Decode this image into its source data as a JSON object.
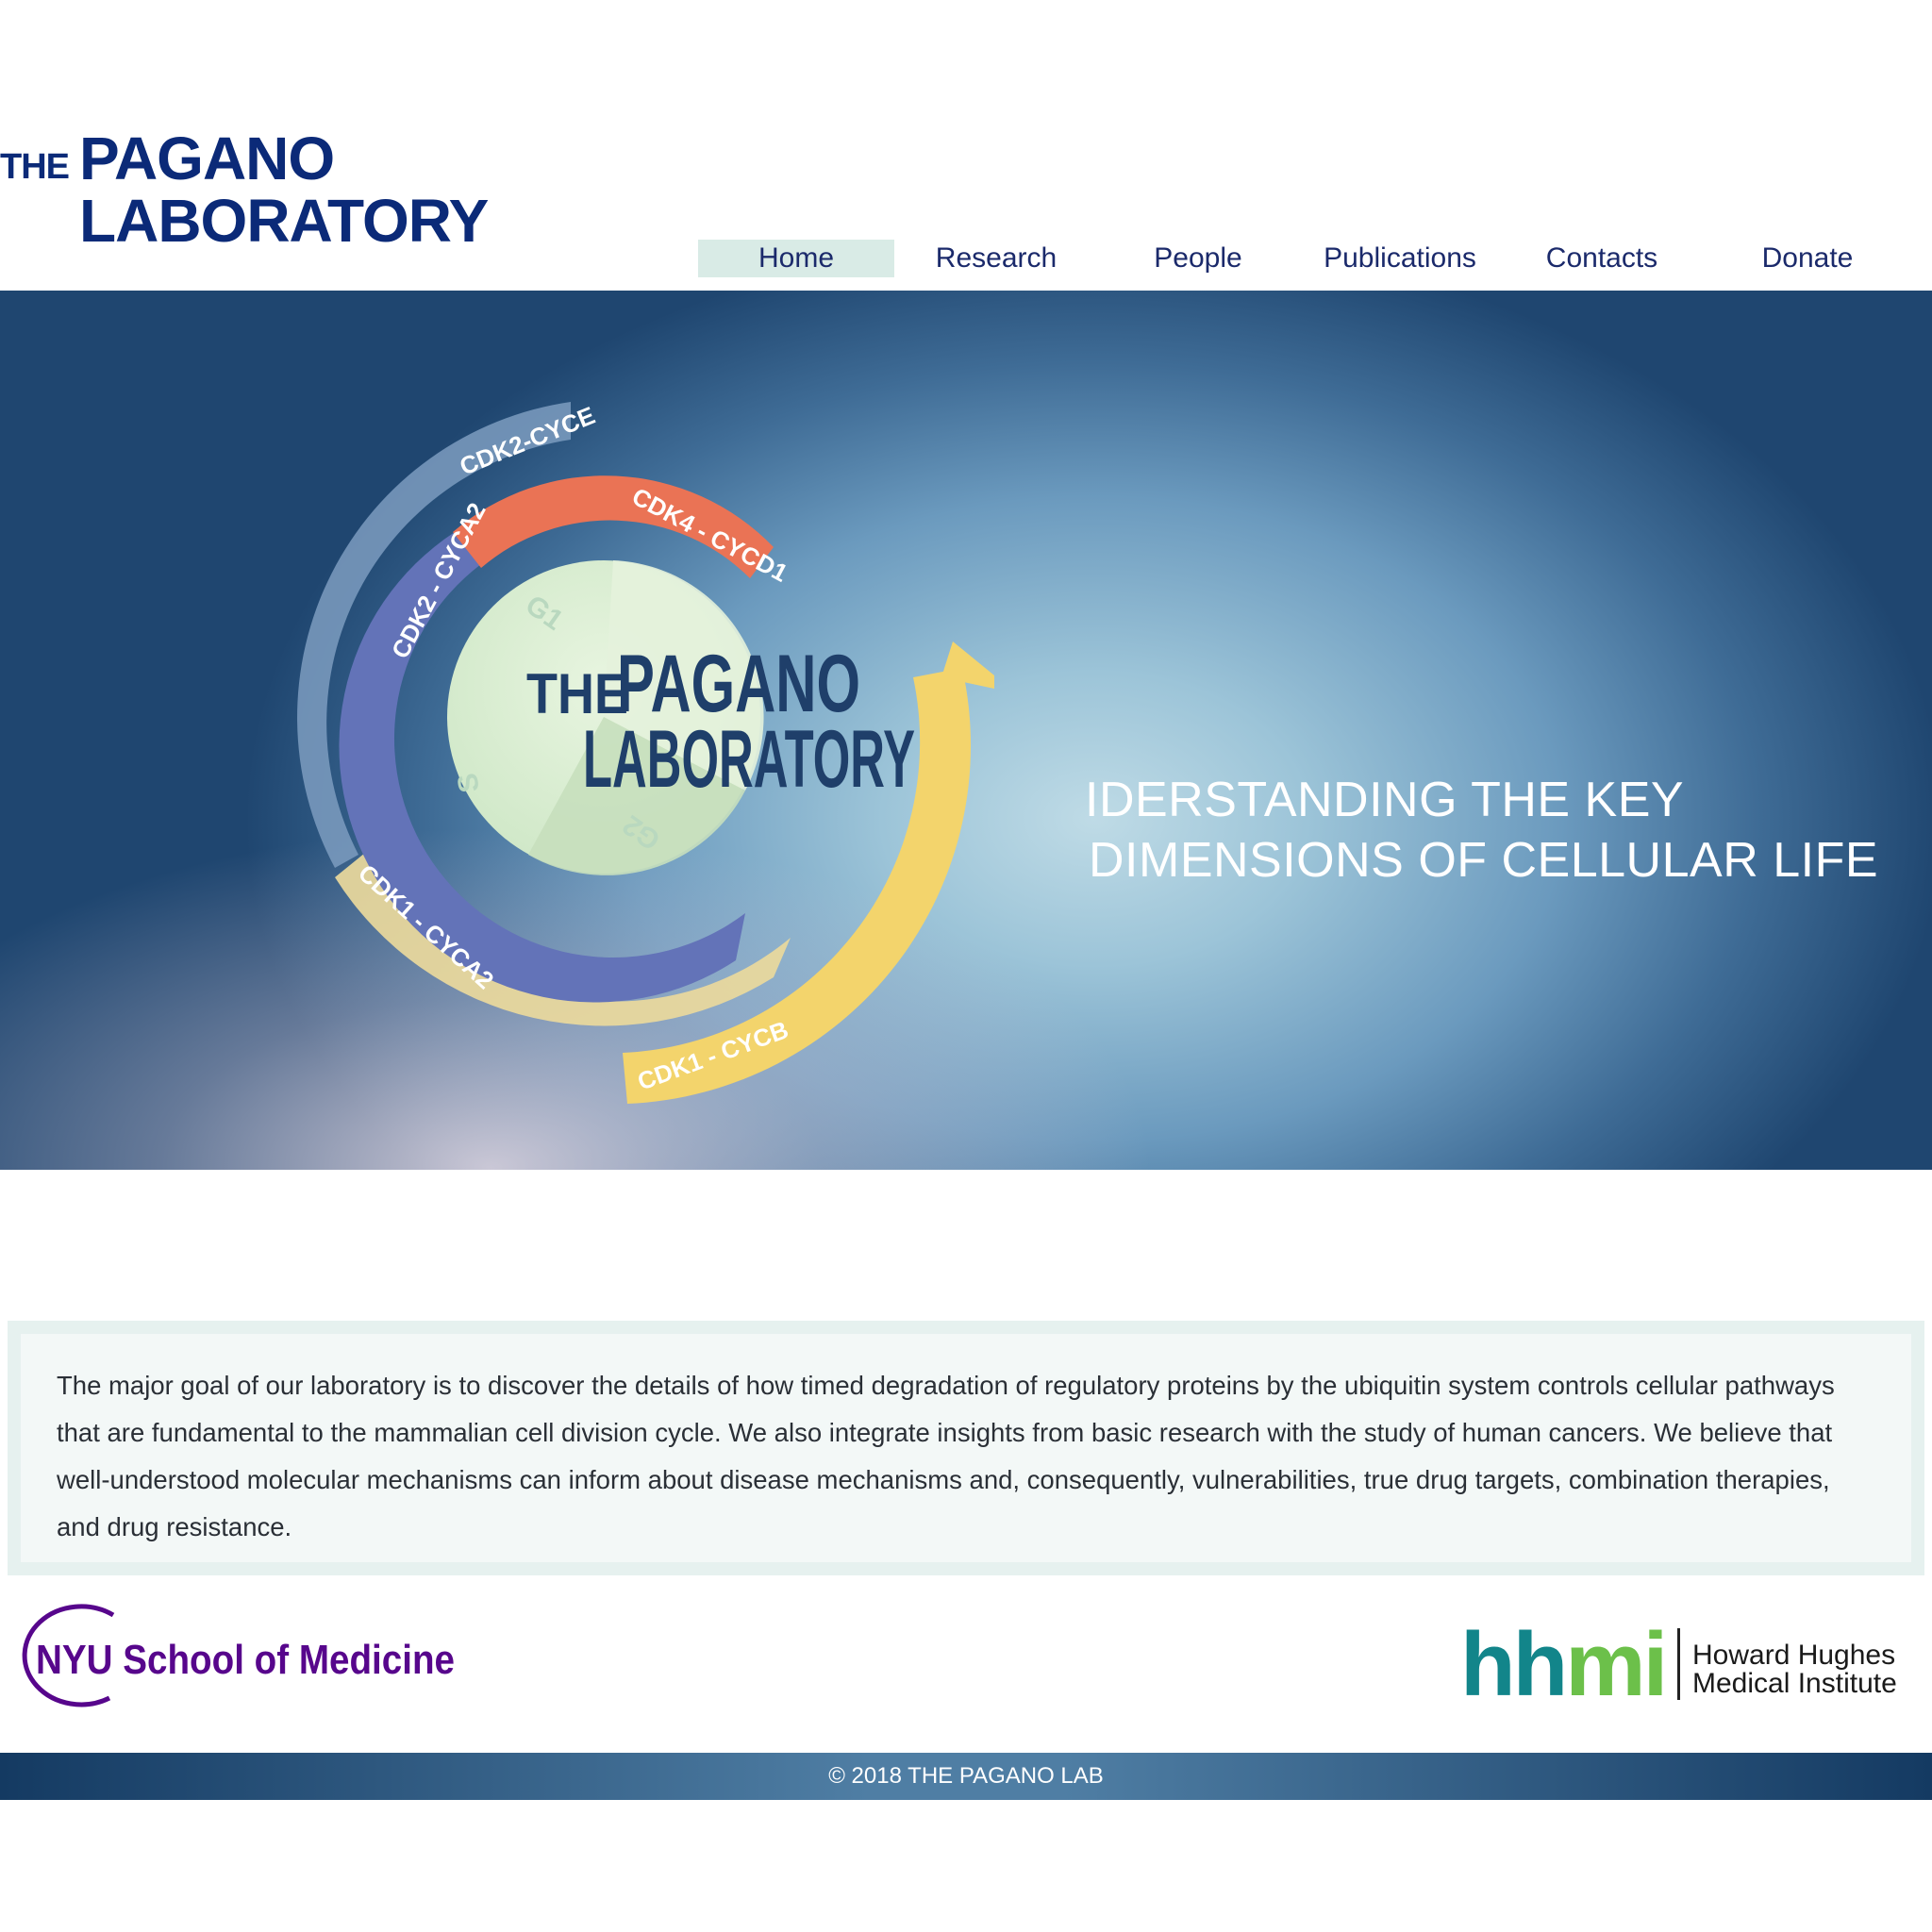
{
  "logo": {
    "the": "THE",
    "pagano": "PAGANO",
    "laboratory": "LABORATORY"
  },
  "nav": {
    "items": [
      {
        "label": "Home",
        "active": true
      },
      {
        "label": "Research"
      },
      {
        "label": "People"
      },
      {
        "label": "Publications"
      },
      {
        "label": "Contacts"
      },
      {
        "label": "Donate"
      }
    ]
  },
  "hero": {
    "graphic": {
      "center_the": "THE",
      "center_pagano": "PAGANO",
      "center_laboratory": "LABORATORY",
      "phases": [
        "G1",
        "S",
        "G2"
      ],
      "arcs": [
        "CDK2-CYCE",
        "CDK4 - CYCD1",
        "CDK2 - CYCA2",
        "CDK1 - CYCA2",
        "CDK1 - CYCB"
      ]
    },
    "tagline_line1": "IDERSTANDING THE KEY",
    "tagline_line2": "DIMENSIONS OF CELLULAR LIFE"
  },
  "mission": {
    "text": "The major goal of our laboratory is to discover the details of how timed degradation of regulatory proteins by the ubiquitin system controls cellular pathways that are fundamental to the mammalian cell division cycle. We also integrate insights from basic research with the study of human cancers. We believe that well-understood molecular mechanisms can inform about disease mechanisms and, consequently, vulnerabilities, true drug targets, combination therapies, and drug resistance."
  },
  "partners": {
    "nyu": "NYU School of Medicine",
    "hhmi_mark": "hhmi",
    "hhmi_line1": "Howard Hughes",
    "hhmi_line2": "Medical Institute"
  },
  "colors": {
    "brand_navy": "#0b2a78",
    "nav_active_bg": "#d9ebe6",
    "arc_orange": "#ea7355",
    "arc_purple": "#6373b8",
    "arc_yellow": "#f3d46c",
    "nyu_purple": "#57068c",
    "hhmi_teal": "#12858a",
    "hhmi_green": "#6cc04a"
  },
  "footer": {
    "copyright": "© 2018 THE PAGANO LAB"
  }
}
